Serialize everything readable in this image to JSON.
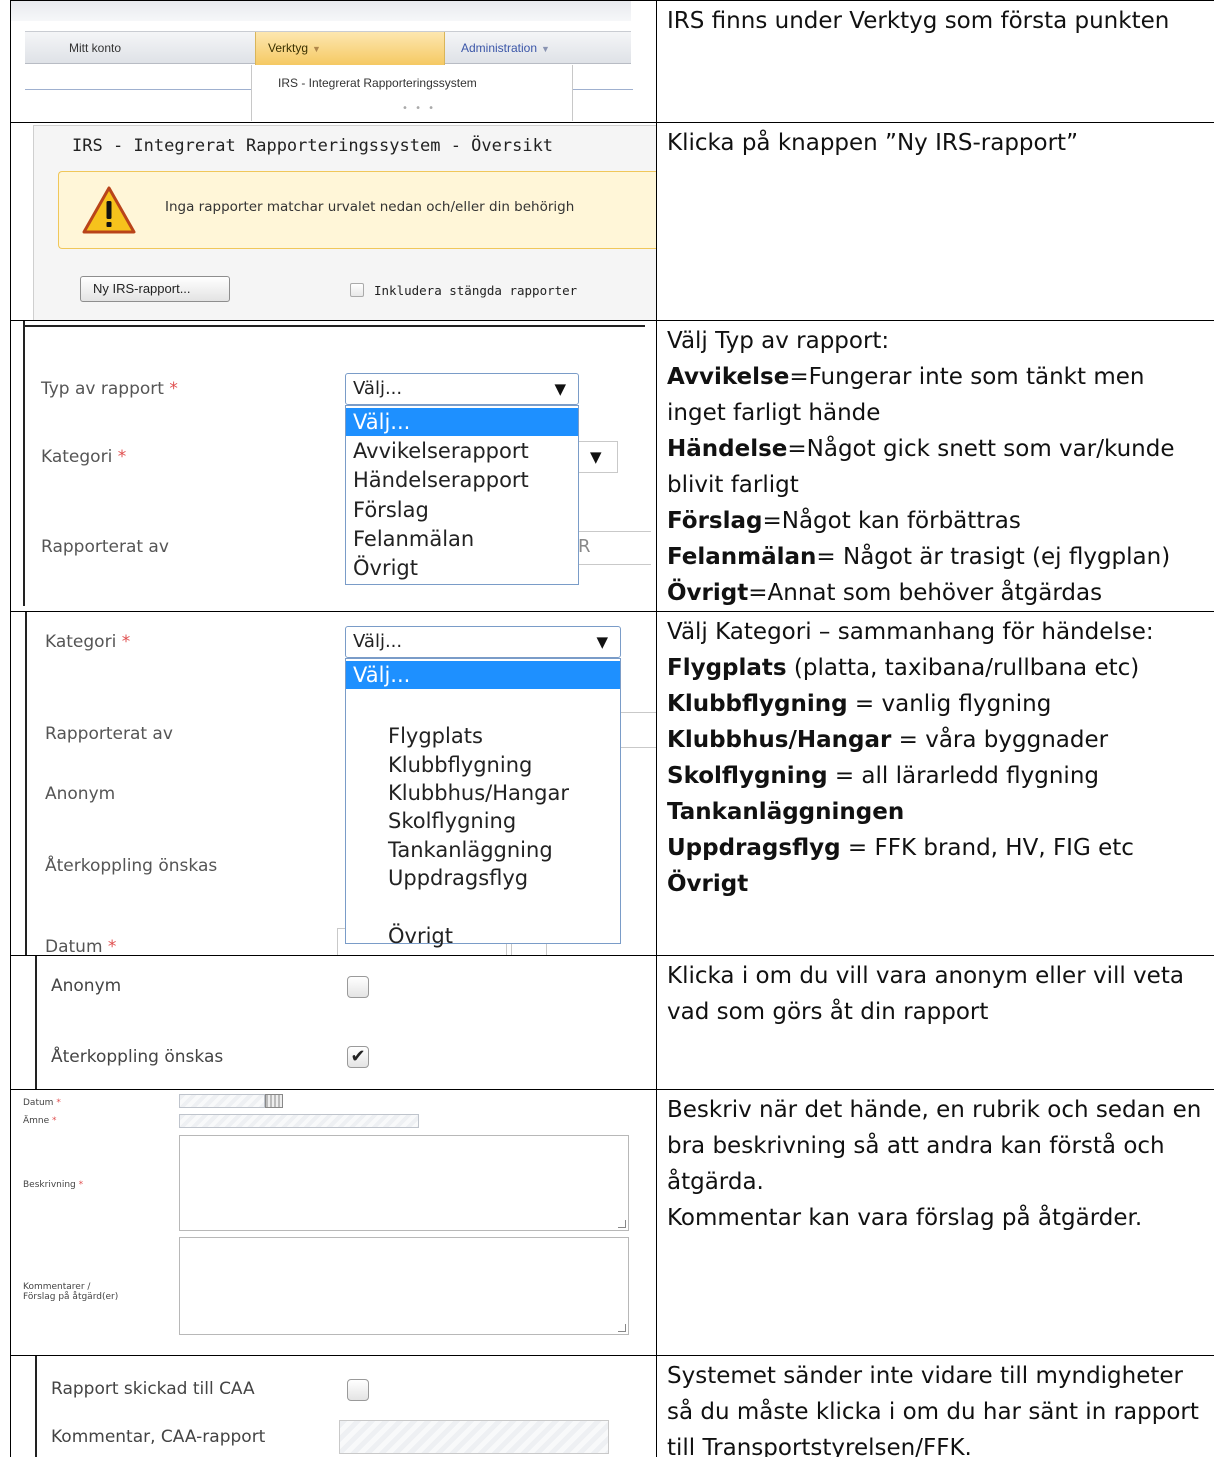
{
  "rows": [
    {
      "shot": {
        "menu": {
          "mitt_konto": "Mitt konto",
          "verktyg": "Verktyg",
          "administration": "Administration",
          "caret": "▼"
        },
        "dropdown_item": "IRS - Integrerat Rapporteringssystem",
        "dots": "• • •"
      },
      "text": "IRS finns under Verktyg som första punkten"
    },
    {
      "shot": {
        "title": "IRS - Integrerat Rapporteringssystem - Översikt",
        "warning": "Inga rapporter matchar urvalet nedan och/eller din behörigh",
        "new_button": "Ny IRS-rapport...",
        "include_closed": "Inkludera stängda rapporter"
      },
      "text": "Klicka på knappen ”Ny IRS-rapport”"
    },
    {
      "shot": {
        "typ_label": "Typ av rapport",
        "kategori_label": "Kategori",
        "rapporterat_label": "Rapporterat av",
        "req": "*",
        "select_value": "Välj...",
        "arrow": "▼",
        "cut_char": "R",
        "options": [
          "Välj...",
          "Avvikelserapport",
          "Händelserapport",
          "Förslag",
          "Felanmälan",
          "Övrigt"
        ]
      },
      "text": {
        "intro": "Välj Typ av rapport:",
        "items": [
          {
            "term": "Avvikelse",
            "desc": "=Fungerar inte som tänkt men inget farligt hände"
          },
          {
            "term": "Händelse",
            "desc": "=Något gick snett som var/kunde blivit farligt"
          },
          {
            "term": "Förslag",
            "desc": "=Något kan förbättras"
          },
          {
            "term": "Felanmälan",
            "desc": "= Något är trasigt (ej flygplan)"
          },
          {
            "term": "Övrigt",
            "desc": "=Annat som behöver åtgärdas"
          }
        ]
      }
    },
    {
      "shot": {
        "kategori_label": "Kategori",
        "rapporterat_label": "Rapporterat av",
        "anonym_label": "Anonym",
        "aterkoppling_label": "Återkoppling önskas",
        "datum_label": "Datum",
        "req": "*",
        "select_value": "Välj...",
        "arrow": "▼",
        "selected_option": "Välj...",
        "options": [
          "Flygplats",
          "Klubbflygning",
          "Klubbhus/Hangar",
          "Skolflygning",
          "Tankanläggning",
          "Uppdragsflyg"
        ],
        "last_option": "Övrigt"
      },
      "text": {
        "intro": "Välj Kategori – sammanhang för händelse:",
        "items": [
          {
            "term": "Flygplats",
            "desc": " (platta, taxibana/rullbana etc)"
          },
          {
            "term": "Klubbflygning",
            "desc": " = vanlig flygning"
          },
          {
            "term": "Klubbhus/Hangar",
            "desc": " = våra byggnader"
          },
          {
            "term": "Skolflygning",
            "desc": " = all lärarledd flygning"
          },
          {
            "term": "Tankanläggningen",
            "desc": ""
          },
          {
            "term": "Uppdragsflyg",
            "desc": " = FFK brand, HV, FIG etc"
          },
          {
            "term": "Övrigt",
            "desc": ""
          }
        ]
      }
    },
    {
      "shot": {
        "anonym_label": "Anonym",
        "aterkoppling_label": "Återkoppling önskas",
        "anonym_checked": false,
        "aterkoppling_checked": true,
        "checkmark": "✔"
      },
      "text": "Klicka i om du vill vara anonym eller vill veta vad som görs åt din rapport"
    },
    {
      "shot": {
        "datum_label": "Datum",
        "amne_label": "Ämne",
        "beskrivning_label": "Beskrivning",
        "kommentarer_label_1": "Kommentarer /",
        "kommentarer_label_2": "Förslag på åtgärd(er)",
        "req": "*"
      },
      "text": {
        "line1": "Beskriv när det hände, en rubrik och sedan en bra beskrivning så att andra kan förstå och åtgärda.",
        "line2": "Kommentar kan vara förslag på åtgärder."
      }
    },
    {
      "shot": {
        "caa_label": "Rapport skickad till CAA",
        "caa_comment_label": "Kommentar, CAA-rapport"
      },
      "text": "Systemet sänder inte vidare till myndigheter så du måste klicka i om du har sänt in rapport till Transportstyrelsen/FFK."
    }
  ]
}
